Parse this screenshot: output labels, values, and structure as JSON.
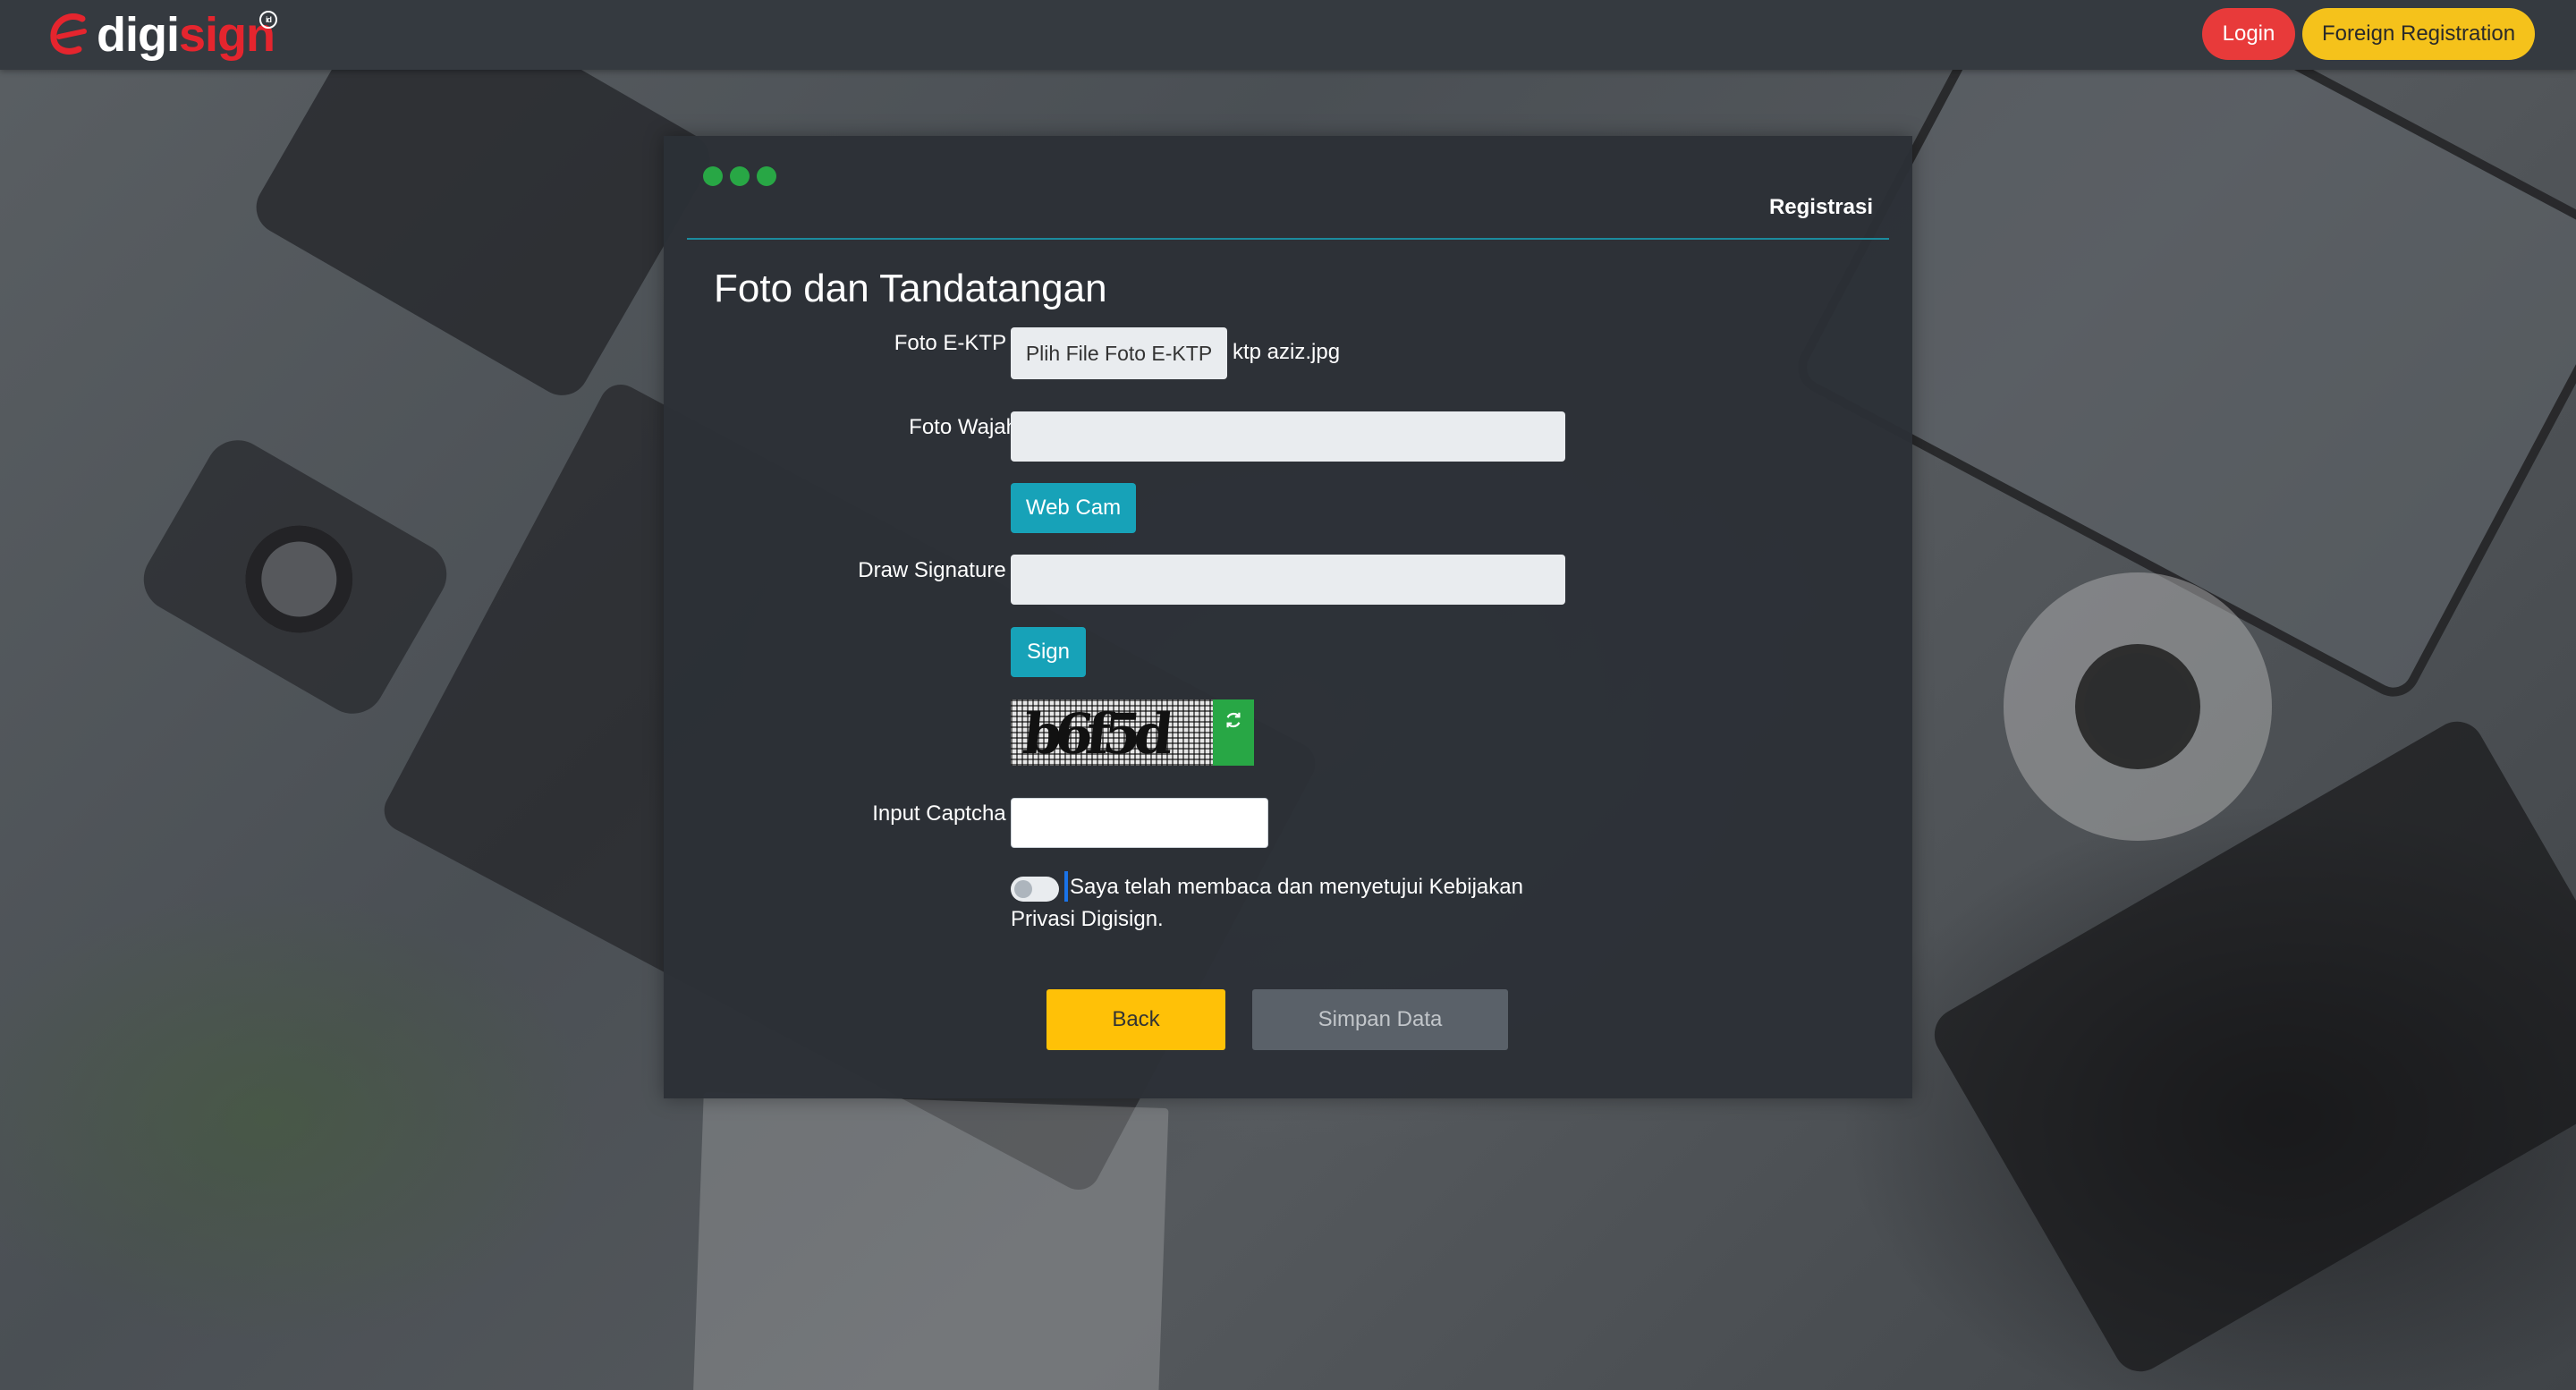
{
  "header": {
    "logo_text_1": "digi",
    "logo_text_2": "sign",
    "logo_badge": "id",
    "login_label": "Login",
    "foreign_registration_label": "Foreign Registration"
  },
  "card": {
    "header_title": "Registrasi",
    "section_title": "Foto dan Tandatangan",
    "fields": {
      "foto_ektp": {
        "label": "Foto E-KTP :",
        "button_label": "Plih File Foto E-KTP",
        "file_name": "ktp aziz.jpg"
      },
      "foto_wajah": {
        "label": "Foto Wajah",
        "button_label": "Web Cam"
      },
      "signature": {
        "label": "Draw Signature :",
        "button_label": "Sign"
      },
      "captcha": {
        "image_text": "b6f5d",
        "refresh_icon": "refresh-icon",
        "input_label": "Input Captcha :",
        "input_value": ""
      },
      "consent": {
        "text": "Saya telah membaca dan menyetujui Kebijakan Privasi Digisign."
      }
    },
    "buttons": {
      "back": "Back",
      "save": "Simpan Data"
    }
  },
  "colors": {
    "accent_teal": "#17a2b8",
    "login_red": "#e83a3a",
    "foreign_yellow": "#f5c21b",
    "back_yellow": "#ffc107",
    "dot_green": "#28a745"
  }
}
